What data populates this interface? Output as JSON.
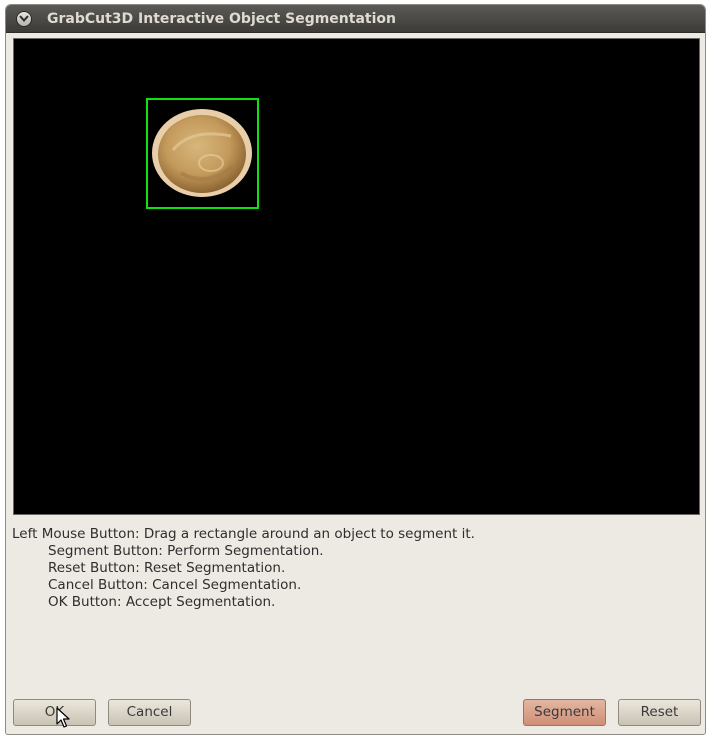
{
  "window": {
    "title": "GrabCut3D Interactive Object Segmentation"
  },
  "instructions": {
    "line1": "Left Mouse Button: Drag a rectangle around an object to segment it.",
    "line2": "Segment Button: Perform Segmentation.",
    "line3": "Reset Button: Reset Segmentation.",
    "line4": "Cancel Button: Cancel Segmentation.",
    "line5": "OK Button: Accept Segmentation."
  },
  "buttons": {
    "ok": "OK",
    "cancel": "Cancel",
    "segment": "Segment",
    "reset": "Reset"
  },
  "colors": {
    "selection_rect": "#10e010",
    "canvas_background": "#000000",
    "segment_button": "#d49a84"
  },
  "icons": {
    "window_menu": "chevron-down-icon",
    "cursor": "arrow-cursor-icon"
  }
}
